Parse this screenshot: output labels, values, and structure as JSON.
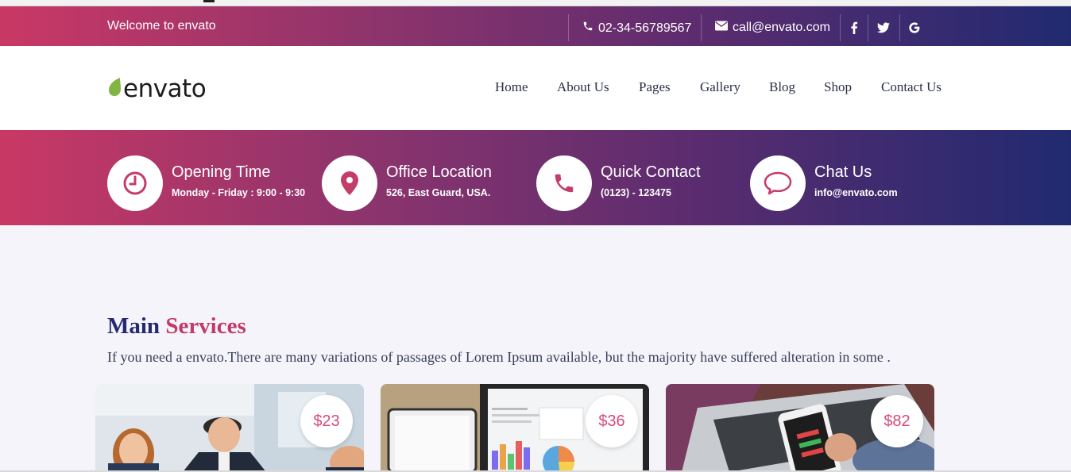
{
  "topbar": {
    "welcome": "Welcome to envato",
    "phone": "02-34-56789567",
    "email": "call@envato.com",
    "social": [
      "facebook-icon",
      "twitter-icon",
      "google-icon"
    ]
  },
  "logo": {
    "text": "envato",
    "leaf_color": "#82b541"
  },
  "nav": [
    "Home",
    "About Us",
    "Pages",
    "Gallery",
    "Blog",
    "Shop",
    "Contact Us"
  ],
  "info_band": [
    {
      "title": "Opening Time",
      "sub": "Monday - Friday : 9:00 - 9:30",
      "icon": "clock-icon"
    },
    {
      "title": "Office Location",
      "sub": "526, East Guard, USA.",
      "icon": "map-pin-icon"
    },
    {
      "title": "Quick Contact",
      "sub": "(0123) - 123475",
      "icon": "phone-icon"
    },
    {
      "title": "Chat Us",
      "sub": "info@envato.com",
      "icon": "chat-bubble-icon"
    }
  ],
  "services": {
    "title_a": "Main",
    "title_b": "Services",
    "description": "If you need a envato.There are many variations of passages of Lorem Ipsum available, but the majority have suffered alteration in some .",
    "cards": [
      {
        "price": "$23"
      },
      {
        "price": "$36"
      },
      {
        "price": "$82"
      }
    ]
  },
  "colors": {
    "accent": "#c23b67",
    "navy": "#252a6e",
    "gradient_start": "#c93865",
    "gradient_end": "#212a70"
  }
}
